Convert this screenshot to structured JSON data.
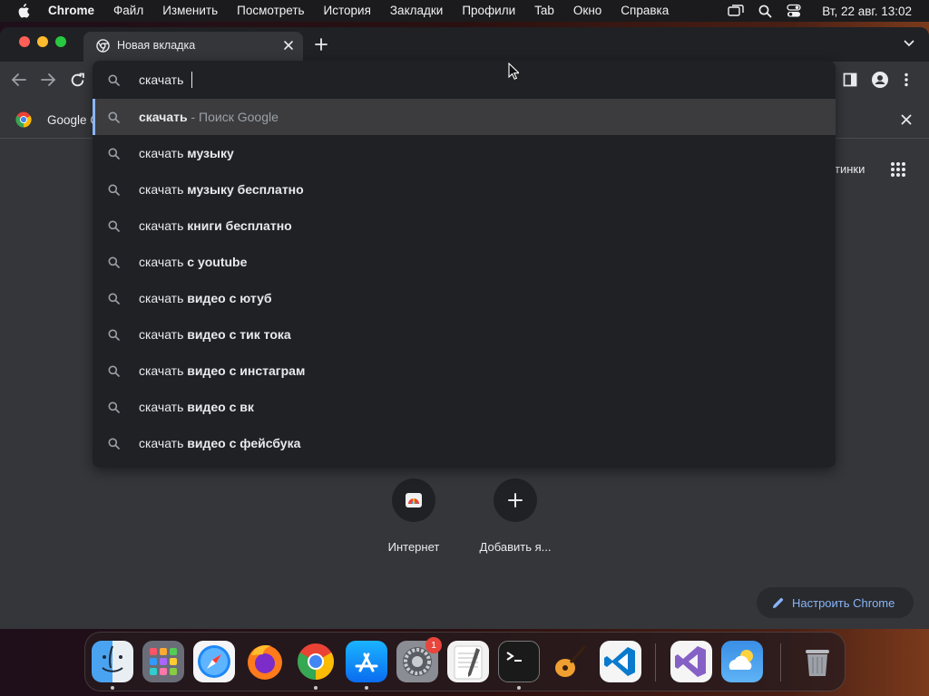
{
  "menubar": {
    "app": "Chrome",
    "items": [
      "Файл",
      "Изменить",
      "Посмотреть",
      "История",
      "Закладки",
      "Профили",
      "Tab",
      "Окно",
      "Справка"
    ],
    "clock": "Вт, 22 авг.  13:02"
  },
  "tab": {
    "title": "Новая вкладка"
  },
  "infobar": {
    "text": "Google C"
  },
  "omnibox": {
    "input": "скачать",
    "suggestions": [
      {
        "typed": "скачать",
        "rest": "",
        "secondary": " - Поиск Google"
      },
      {
        "typed": "скачать",
        "rest": " музыку",
        "secondary": ""
      },
      {
        "typed": "скачать",
        "rest": " музыку бесплатно",
        "secondary": ""
      },
      {
        "typed": "скачать",
        "rest": " книги бесплатно",
        "secondary": ""
      },
      {
        "typed": "скачать",
        "rest": " с youtube",
        "secondary": ""
      },
      {
        "typed": "скачать",
        "rest": " видео с ютуб",
        "secondary": ""
      },
      {
        "typed": "скачать",
        "rest": " видео с тик тока",
        "secondary": ""
      },
      {
        "typed": "скачать",
        "rest": " видео с инстаграм",
        "secondary": ""
      },
      {
        "typed": "скачать",
        "rest": " видео с вк",
        "secondary": ""
      },
      {
        "typed": "скачать",
        "rest": " видео с фейсбука",
        "secondary": ""
      }
    ]
  },
  "ntp": {
    "images_link": "тинки",
    "shortcuts": [
      {
        "label": "Интернет"
      },
      {
        "label": "Добавить я..."
      }
    ],
    "customize": "Настроить Chrome"
  },
  "dock": {
    "apps": [
      "finder",
      "launchpad",
      "safari",
      "firefox",
      "chrome",
      "app-store",
      "system-settings",
      "textedit",
      "terminal",
      "garageband",
      "vscode",
      "visual-studio",
      "weather",
      "trash"
    ],
    "badge": "1"
  },
  "colors": {
    "accent": "#8ab4f8",
    "window_bg": "#35363a",
    "tabstrip_bg": "#202124",
    "omnibox_bg": "#202124",
    "selected_row": "#3c3c3f"
  }
}
